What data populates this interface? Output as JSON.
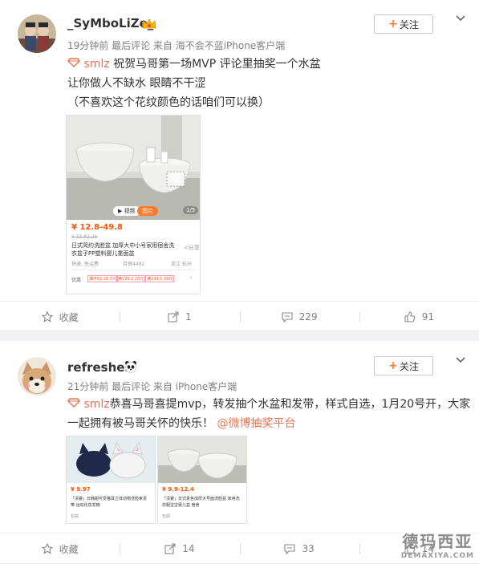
{
  "posts": [
    {
      "username": "_SyMboLiZe_",
      "meta": "19分钟前 最后评论 来自 海不会不蓝iPhone客户端",
      "follow_label": "关注",
      "mention": "smlz",
      "lines": [
        "祝贺马哥第一场MVP 评论里抽奖一个水盆",
        "让你做人不缺水 眼睛不干涩",
        "（不喜欢这个花纹颜色的话咱们可以换）"
      ],
      "product": {
        "price": "¥ 12.8-49.8",
        "orig_price": "¥ 15.82.26",
        "title": "日式简约洗脸盆 加厚大中小号家用宿舍洗衣盆子PP塑料婴儿重面盆",
        "row_left": "快递: 免运费",
        "row_mid": "月销4492",
        "row_right": "浙江 杭州",
        "badge": "1/5",
        "tag": "优惠",
        "coupons": [
          "满件62.26 5元",
          "满199.2 20元",
          "满199.5 39元"
        ]
      },
      "actions": {
        "fav": "收藏",
        "share": "1",
        "comment": "229",
        "like": "91"
      }
    },
    {
      "username": "refreshes",
      "meta": "21分钟前 最后评论 来自 iPhone客户端",
      "follow_label": "关注",
      "mention": "smlz",
      "text_a": "恭喜马哥喜提mvp，转发抽个水盆和发带，样式自选，1月20号开，大家",
      "text_b": "一起拥有被马哥关怀的快乐！",
      "lottery": "@微博抽奖平台",
      "products": [
        {
          "price": "¥ 9.97",
          "title": "「清宴」日韩甜可爱猫耳立体动物洗脸束发带 运动化妆发箍",
          "ship": "包邮"
        },
        {
          "price": "¥ 9.9-12.4",
          "title": "「清宴」日式素色加厚大号面洗脸盆 家用洗衣服宝宝婴儿盆 宿舍",
          "ship": "包邮"
        }
      ],
      "actions": {
        "fav": "收藏",
        "share": "14",
        "comment": "33",
        "like": "14"
      }
    }
  ],
  "watermark": {
    "big": "德玛西亚",
    "small": "DEMAXIYA.COM"
  }
}
